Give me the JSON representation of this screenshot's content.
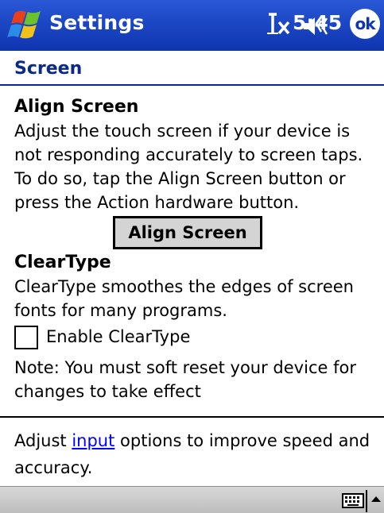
{
  "titlebar": {
    "title": "Settings",
    "clock": "5:45",
    "ok_label": "ok",
    "icons": [
      "windows-start-icon",
      "connectivity-icon",
      "volume-icon"
    ],
    "accent_color": "#1c47c4"
  },
  "page": {
    "header": "Screen",
    "header_color": "#0a2a8a"
  },
  "align": {
    "title": "Align Screen",
    "description": "Adjust the touch screen if your device is not responding accurately to screen taps. To do so, tap the Align Screen button or press the Action hardware button.",
    "button_label": "Align Screen"
  },
  "cleartype": {
    "title": "ClearType",
    "description": "ClearType smoothes the edges of screen fonts for many programs.",
    "checkbox_label": "Enable ClearType",
    "checked": false,
    "note": "Note: You must soft reset your device for changes to take effect"
  },
  "footer": {
    "prefix": "Adjust ",
    "link": "input",
    "suffix": " options to improve speed and accuracy."
  },
  "menubar": {
    "icons": [
      "keyboard-icon",
      "sip-arrow-icon"
    ]
  }
}
